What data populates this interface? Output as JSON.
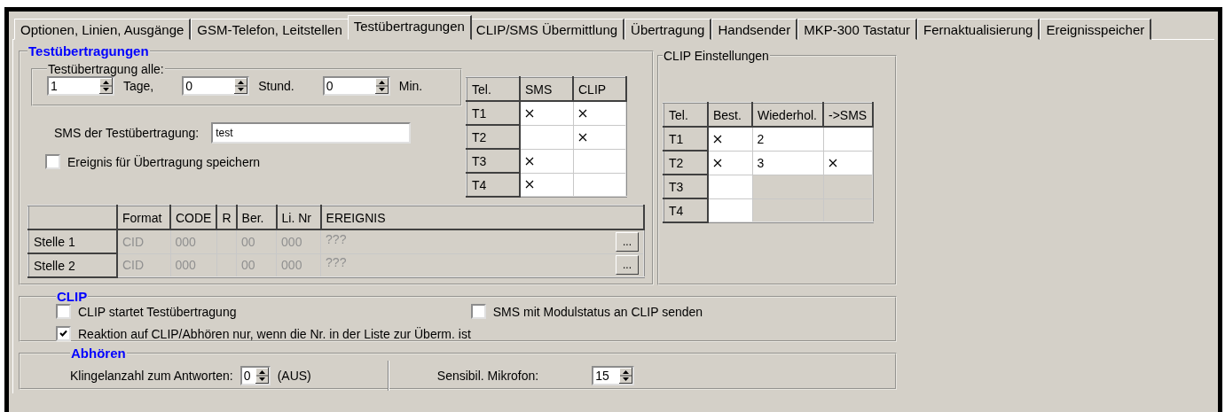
{
  "tabs": [
    {
      "label": "Optionen, Linien, Ausgänge",
      "selected": false
    },
    {
      "label": "GSM-Telefon, Leitstellen",
      "selected": false
    },
    {
      "label": "Testübertragungen",
      "selected": true
    },
    {
      "label": "CLIP/SMS Übermittlung",
      "selected": false
    },
    {
      "label": "Übertragung",
      "selected": false
    },
    {
      "label": "Handsender",
      "selected": false
    },
    {
      "label": "MKP-300 Tastatur",
      "selected": false
    },
    {
      "label": "Fernaktualisierung",
      "selected": false
    },
    {
      "label": "Ereignisspeicher",
      "selected": false
    }
  ],
  "test_transmission": {
    "title": "Testübertragungen",
    "interval": {
      "title": "Testübertragung alle:",
      "fields": [
        {
          "value": "1",
          "unit": "Tage,"
        },
        {
          "value": "0",
          "unit": "Stund."
        },
        {
          "value": "0",
          "unit": "Min."
        }
      ]
    },
    "sms_text": {
      "label": "SMS der Testübertragung:",
      "value": "test"
    },
    "save_event": {
      "label": "Ereignis für Übertragung speichern",
      "checked": false
    },
    "phone_table": {
      "columns": [
        "Tel.",
        "SMS",
        "CLIP"
      ],
      "rows": [
        {
          "tel": "T1",
          "sms": true,
          "clip": true
        },
        {
          "tel": "T2",
          "sms": false,
          "clip": true
        },
        {
          "tel": "T3",
          "sms": true,
          "clip": false
        },
        {
          "tel": "T4",
          "sms": true,
          "clip": false
        }
      ]
    },
    "stations": {
      "columns": [
        "Format",
        "CODE",
        "R",
        "Ber.",
        "Li. Nr",
        "EREIGNIS"
      ],
      "rows": [
        {
          "name": "Stelle 1",
          "disabled": true,
          "format": "CID",
          "code": "000",
          "ber": "00",
          "li_nr": "000",
          "event": "???",
          "button": "..."
        },
        {
          "name": "Stelle 2",
          "disabled": true,
          "format": "CID",
          "code": "000",
          "ber": "00",
          "li_nr": "000",
          "event": "???",
          "button": "..."
        }
      ]
    }
  },
  "clip_settings": {
    "title": "CLIP Einstellungen",
    "columns": [
      "Tel.",
      "Best.",
      "Wiederhol.",
      "->SMS"
    ],
    "rows": [
      {
        "tel": "T1",
        "confirm": true,
        "repeat": "2",
        "to_sms": false,
        "disabled": false
      },
      {
        "tel": "T2",
        "confirm": true,
        "repeat": "3",
        "to_sms": true,
        "disabled": false
      },
      {
        "tel": "T3",
        "confirm": false,
        "to_sms": false,
        "disabled": true
      },
      {
        "tel": "T4",
        "confirm": false,
        "to_sms": false,
        "disabled": true
      }
    ]
  },
  "clip": {
    "title": "CLIP",
    "left": [
      {
        "label": "CLIP startet Testübertragung",
        "checked": false
      },
      {
        "label": "Reaktion auf CLIP/Abhören nur, wenn die Nr. in der Liste zur Überm. ist",
        "checked": true
      }
    ],
    "right": [
      {
        "label": "SMS mit Modulstatus an CLIP senden",
        "checked": false
      }
    ]
  },
  "listening": {
    "title": "Abhören",
    "rings": {
      "label": "Klingelanzahl zum Antworten:",
      "value": "0",
      "note": "(AUS)"
    },
    "microphone": {
      "label": "Sensibil. Mikrofon:",
      "value": "15"
    }
  }
}
